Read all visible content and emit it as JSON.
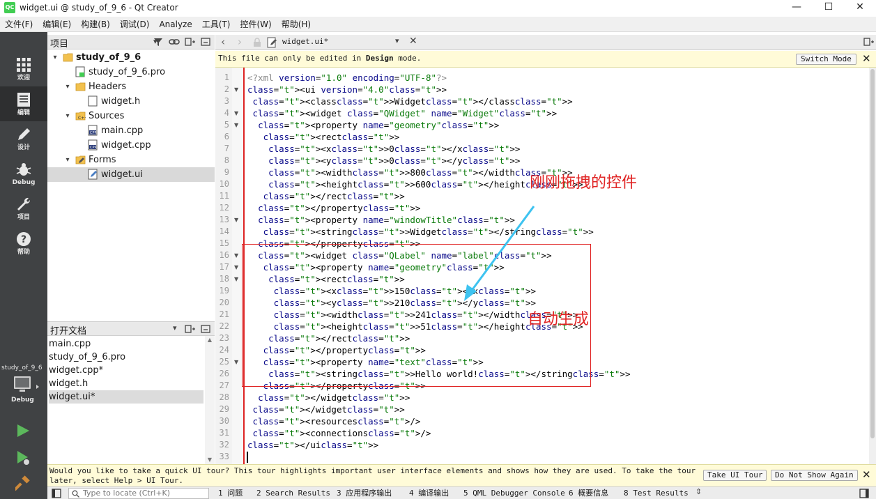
{
  "window": {
    "app_icon": "QC",
    "title": "widget.ui @ study_of_9_6 - Qt Creator",
    "minimize": "—",
    "maximize": "☐",
    "close": "✕"
  },
  "menu": [
    "文件(F)",
    "编辑(E)",
    "构建(B)",
    "调试(D)",
    "Analyze",
    "工具(T)",
    "控件(W)",
    "帮助(H)"
  ],
  "modes": [
    {
      "label": "欢迎",
      "icon": "grid-icon"
    },
    {
      "label": "编辑",
      "icon": "edit-document-icon"
    },
    {
      "label": "设计",
      "icon": "pencil-icon"
    },
    {
      "label": "Debug",
      "icon": "bug-icon"
    },
    {
      "label": "项目",
      "icon": "wrench-icon"
    },
    {
      "label": "帮助",
      "icon": "help-icon"
    }
  ],
  "kit": {
    "project": "study_of_9_6",
    "mode": "Debug"
  },
  "project_pane": {
    "title": "项目",
    "tree": [
      {
        "label": "study_of_9_6",
        "level": 0,
        "arrow": "▾",
        "icon": "project-folder-icon",
        "bold": true
      },
      {
        "label": "study_of_9_6.pro",
        "level": 1,
        "arrow": "",
        "icon": "pro-file-icon"
      },
      {
        "label": "Headers",
        "level": 1,
        "arrow": "▾",
        "icon": "folder-icon"
      },
      {
        "label": "widget.h",
        "level": 2,
        "arrow": "",
        "icon": "header-file-icon"
      },
      {
        "label": "Sources",
        "level": 1,
        "arrow": "▾",
        "icon": "sources-folder-icon"
      },
      {
        "label": "main.cpp",
        "level": 2,
        "arrow": "",
        "icon": "cpp-file-icon"
      },
      {
        "label": "widget.cpp",
        "level": 2,
        "arrow": "",
        "icon": "cpp-file-icon"
      },
      {
        "label": "Forms",
        "level": 1,
        "arrow": "▾",
        "icon": "forms-folder-icon"
      },
      {
        "label": "widget.ui",
        "level": 2,
        "arrow": "",
        "icon": "ui-file-icon",
        "selected": true
      }
    ]
  },
  "open_docs": {
    "title": "打开文档",
    "items": [
      {
        "label": "main.cpp"
      },
      {
        "label": "study_of_9_6.pro"
      },
      {
        "label": "widget.cpp*"
      },
      {
        "label": "widget.h"
      },
      {
        "label": "widget.ui*",
        "selected": true
      }
    ]
  },
  "editor": {
    "current_file": "widget.ui*",
    "info_prefix": "This file can only be edited in ",
    "info_bold": "Design",
    "info_suffix": " mode.",
    "switch_mode": "Switch Mode",
    "lines": [
      "<?xml version=\"1.0\" encoding=\"UTF-8\"?>",
      "<ui version=\"4.0\">",
      " <class>Widget</class>",
      " <widget class=\"QWidget\" name=\"Widget\">",
      "  <property name=\"geometry\">",
      "   <rect>",
      "    <x>0</x>",
      "    <y>0</y>",
      "    <width>800</width>",
      "    <height>600</height>",
      "   </rect>",
      "  </property>",
      "  <property name=\"windowTitle\">",
      "   <string>Widget</string>",
      "  </property>",
      "  <widget class=\"QLabel\" name=\"label\">",
      "   <property name=\"geometry\">",
      "    <rect>",
      "     <x>150</x>",
      "     <y>210</y>",
      "     <width>241</width>",
      "     <height>51</height>",
      "    </rect>",
      "   </property>",
      "   <property name=\"text\">",
      "    <string>Hello world!</string>",
      "   </property>",
      "  </widget>",
      " </widget>",
      " <resources/>",
      " <connections/>",
      "</ui>",
      ""
    ],
    "folds": [
      2,
      4,
      5,
      13,
      16,
      17,
      18,
      25
    ]
  },
  "annotations": {
    "dragged_label": "刚刚拖拽的控件",
    "auto_label": "自动生成",
    "color": "#e02424",
    "arrow_color": "#3ec3f0"
  },
  "tour": {
    "text": "Would you like to take a quick UI tour? This tour highlights important user interface elements and shows how they are used. To take the tour later, select Help > UI Tour.",
    "take": "Take UI Tour",
    "dont_show": "Do Not Show Again",
    "close": "✕"
  },
  "statusbar": {
    "locator_placeholder": "Type to locate (Ctrl+K)",
    "tabs": [
      "1 问题",
      "2 Search Results",
      "3 应用程序输出",
      "4 编译输出",
      "5 QML Debugger Console",
      "6 概要信息",
      "8 Test Results"
    ]
  }
}
